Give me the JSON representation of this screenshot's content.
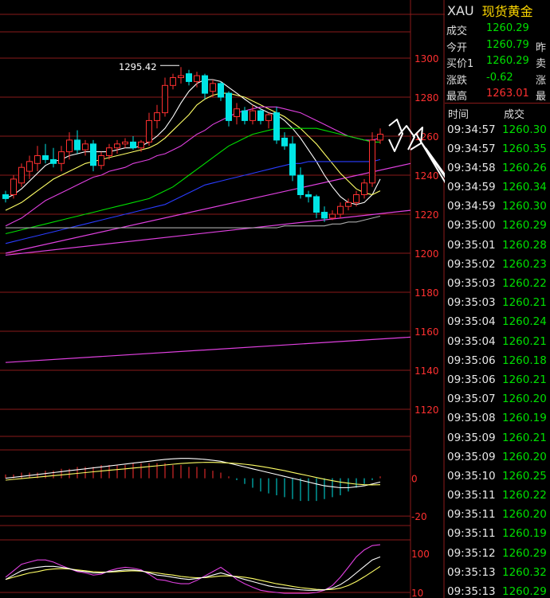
{
  "quote_panel": {
    "symbol": "XAU",
    "name": "现货黄金",
    "rows": [
      {
        "label": "成交",
        "value": "1260.29",
        "color": "green",
        "right": ""
      },
      {
        "label": "今开",
        "value": "1260.79",
        "color": "green",
        "right": "昨"
      },
      {
        "label": "买价1",
        "value": "1260.29",
        "color": "green",
        "right": "卖"
      },
      {
        "label": "涨跌",
        "value": "-0.62",
        "color": "green",
        "right": "涨"
      },
      {
        "label": "最高",
        "value": "1263.01",
        "color": "red",
        "right": "最"
      }
    ]
  },
  "ticks_panel": {
    "headers": {
      "time": "时间",
      "price": "成交"
    },
    "ticks": [
      {
        "time": "09:34:57",
        "price": "1260.30"
      },
      {
        "time": "09:34:57",
        "price": "1260.35"
      },
      {
        "time": "09:34:58",
        "price": "1260.26"
      },
      {
        "time": "09:34:59",
        "price": "1260.34"
      },
      {
        "time": "09:34:59",
        "price": "1260.30"
      },
      {
        "time": "09:35:00",
        "price": "1260.29"
      },
      {
        "time": "09:35:01",
        "price": "1260.28"
      },
      {
        "time": "09:35:02",
        "price": "1260.23"
      },
      {
        "time": "09:35:03",
        "price": "1260.22"
      },
      {
        "time": "09:35:03",
        "price": "1260.21"
      },
      {
        "time": "09:35:04",
        "price": "1260.24"
      },
      {
        "time": "09:35:04",
        "price": "1260.21"
      },
      {
        "time": "09:35:06",
        "price": "1260.18"
      },
      {
        "time": "09:35:06",
        "price": "1260.21"
      },
      {
        "time": "09:35:07",
        "price": "1260.20"
      },
      {
        "time": "09:35:08",
        "price": "1260.19"
      },
      {
        "time": "09:35:09",
        "price": "1260.21"
      },
      {
        "time": "09:35:09",
        "price": "1260.20"
      },
      {
        "time": "09:35:10",
        "price": "1260.25"
      },
      {
        "time": "09:35:11",
        "price": "1260.22"
      },
      {
        "time": "09:35:11",
        "price": "1260.20"
      },
      {
        "time": "09:35:11",
        "price": "1260.19"
      },
      {
        "time": "09:35:12",
        "price": "1260.29"
      },
      {
        "time": "09:35:13",
        "price": "1260.32"
      },
      {
        "time": "09:35:13",
        "price": "1260.29"
      }
    ]
  },
  "colors": {
    "up": "#ff3030",
    "down": "#00e5e5",
    "grid": "#8a1a1a",
    "ma_white": "#ffffff",
    "ma_yellow": "#ffff66",
    "ma_magenta": "#e040e0",
    "ma_green": "#00e000",
    "ma_blue": "#2a3cff",
    "ma_gray": "#aaaaaa"
  },
  "chart_data": [
    {
      "type": "candlestick",
      "annotation": "1295.42",
      "ylim": [
        1110,
        1310
      ],
      "yticks": [
        1300,
        1280,
        1260,
        1240,
        1220,
        1200,
        1180,
        1160,
        1140,
        1120
      ],
      "candles": [
        {
          "o": 1230,
          "h": 1232,
          "l": 1226,
          "c": 1228
        },
        {
          "o": 1230,
          "h": 1240,
          "l": 1228,
          "c": 1238
        },
        {
          "o": 1236,
          "h": 1246,
          "l": 1234,
          "c": 1244
        },
        {
          "o": 1242,
          "h": 1250,
          "l": 1238,
          "c": 1247
        },
        {
          "o": 1246,
          "h": 1255,
          "l": 1242,
          "c": 1250
        },
        {
          "o": 1250,
          "h": 1256,
          "l": 1246,
          "c": 1248
        },
        {
          "o": 1248,
          "h": 1254,
          "l": 1244,
          "c": 1246
        },
        {
          "o": 1246,
          "h": 1255,
          "l": 1242,
          "c": 1252
        },
        {
          "o": 1252,
          "h": 1262,
          "l": 1248,
          "c": 1258
        },
        {
          "o": 1258,
          "h": 1263,
          "l": 1251,
          "c": 1253
        },
        {
          "o": 1253,
          "h": 1258,
          "l": 1250,
          "c": 1256
        },
        {
          "o": 1256,
          "h": 1258,
          "l": 1242,
          "c": 1245
        },
        {
          "o": 1245,
          "h": 1252,
          "l": 1243,
          "c": 1250
        },
        {
          "o": 1250,
          "h": 1256,
          "l": 1248,
          "c": 1254
        },
        {
          "o": 1254,
          "h": 1258,
          "l": 1251,
          "c": 1256
        },
        {
          "o": 1256,
          "h": 1259,
          "l": 1254,
          "c": 1257
        },
        {
          "o": 1257,
          "h": 1260,
          "l": 1253,
          "c": 1254
        },
        {
          "o": 1254,
          "h": 1258,
          "l": 1252,
          "c": 1257
        },
        {
          "o": 1257,
          "h": 1272,
          "l": 1255,
          "c": 1268
        },
        {
          "o": 1268,
          "h": 1276,
          "l": 1264,
          "c": 1272
        },
        {
          "o": 1272,
          "h": 1290,
          "l": 1270,
          "c": 1286
        },
        {
          "o": 1286,
          "h": 1292,
          "l": 1284,
          "c": 1290
        },
        {
          "o": 1290,
          "h": 1295.42,
          "l": 1287,
          "c": 1291
        },
        {
          "o": 1292,
          "h": 1294,
          "l": 1286,
          "c": 1288
        },
        {
          "o": 1288,
          "h": 1293,
          "l": 1285,
          "c": 1291
        },
        {
          "o": 1291,
          "h": 1292,
          "l": 1279,
          "c": 1282
        },
        {
          "o": 1283,
          "h": 1289,
          "l": 1280,
          "c": 1287
        },
        {
          "o": 1287,
          "h": 1288,
          "l": 1278,
          "c": 1280
        },
        {
          "o": 1282,
          "h": 1283,
          "l": 1265,
          "c": 1268
        },
        {
          "o": 1270,
          "h": 1277,
          "l": 1266,
          "c": 1274
        },
        {
          "o": 1273,
          "h": 1275,
          "l": 1266,
          "c": 1268
        },
        {
          "o": 1268,
          "h": 1276,
          "l": 1266,
          "c": 1273
        },
        {
          "o": 1273,
          "h": 1274,
          "l": 1266,
          "c": 1268
        },
        {
          "o": 1268,
          "h": 1272,
          "l": 1264,
          "c": 1271
        },
        {
          "o": 1272,
          "h": 1275,
          "l": 1256,
          "c": 1258
        },
        {
          "o": 1259,
          "h": 1262,
          "l": 1253,
          "c": 1255
        },
        {
          "o": 1256,
          "h": 1260,
          "l": 1237,
          "c": 1240
        },
        {
          "o": 1240,
          "h": 1244,
          "l": 1228,
          "c": 1230
        },
        {
          "o": 1230,
          "h": 1232,
          "l": 1226,
          "c": 1229
        },
        {
          "o": 1229,
          "h": 1230,
          "l": 1218,
          "c": 1221
        },
        {
          "o": 1221,
          "h": 1224,
          "l": 1216,
          "c": 1218
        },
        {
          "o": 1218,
          "h": 1222,
          "l": 1217,
          "c": 1220
        },
        {
          "o": 1220,
          "h": 1226,
          "l": 1218,
          "c": 1224
        },
        {
          "o": 1224,
          "h": 1228,
          "l": 1222,
          "c": 1226
        },
        {
          "o": 1226,
          "h": 1232,
          "l": 1224,
          "c": 1230
        },
        {
          "o": 1230,
          "h": 1238,
          "l": 1228,
          "c": 1236
        },
        {
          "o": 1236,
          "h": 1262,
          "l": 1234,
          "c": 1258
        },
        {
          "o": 1258,
          "h": 1264,
          "l": 1256,
          "c": 1261
        }
      ],
      "ma_lines": [
        {
          "color": "ma_white",
          "values": [
            1228,
            1230,
            1233,
            1237,
            1241,
            1245,
            1247,
            1248,
            1250,
            1251,
            1252,
            1252,
            1252,
            1252,
            1253,
            1254,
            1254,
            1255,
            1257,
            1260,
            1264,
            1270,
            1277,
            1283,
            1287,
            1289,
            1289,
            1288,
            1285,
            1282,
            1279,
            1276,
            1274,
            1272,
            1271,
            1268,
            1264,
            1259,
            1253,
            1247,
            1240,
            1234,
            1229,
            1226,
            1225,
            1226,
            1230,
            1238
          ]
        },
        {
          "color": "ma_yellow",
          "values": [
            1222,
            1224,
            1226,
            1229,
            1232,
            1235,
            1238,
            1240,
            1242,
            1244,
            1246,
            1247,
            1248,
            1249,
            1250,
            1251,
            1252,
            1253,
            1254,
            1256,
            1259,
            1263,
            1267,
            1271,
            1276,
            1279,
            1281,
            1282,
            1282,
            1281,
            1280,
            1278,
            1276,
            1274,
            1272,
            1270,
            1267,
            1264,
            1260,
            1256,
            1251,
            1246,
            1241,
            1237,
            1233,
            1231,
            1230,
            1232
          ]
        },
        {
          "color": "ma_magenta",
          "values": [
            1214,
            1216,
            1218,
            1221,
            1224,
            1227,
            1229,
            1231,
            1233,
            1235,
            1237,
            1239,
            1240,
            1242,
            1243,
            1244,
            1246,
            1247,
            1248,
            1250,
            1251,
            1253,
            1255,
            1258,
            1261,
            1263,
            1266,
            1268,
            1270,
            1272,
            1273,
            1274,
            1275,
            1275,
            1275,
            1274,
            1273,
            1272,
            1270,
            1268,
            1266,
            1264,
            1262,
            1260,
            1259,
            1258,
            1258,
            1259
          ]
        },
        {
          "color": "ma_green",
          "values": [
            1210,
            1211,
            1212,
            1213,
            1214,
            1215,
            1216,
            1217,
            1218,
            1219,
            1220,
            1221,
            1222,
            1223,
            1224,
            1225,
            1226,
            1227,
            1228,
            1230,
            1232,
            1234,
            1237,
            1240,
            1243,
            1246,
            1249,
            1252,
            1255,
            1257,
            1259,
            1261,
            1262,
            1263,
            1264,
            1264,
            1264,
            1264,
            1264,
            1264,
            1263,
            1262,
            1261,
            1260,
            1259,
            1258,
            1257,
            1257
          ]
        },
        {
          "color": "ma_blue",
          "values": [
            1205,
            1206,
            1207,
            1208,
            1209,
            1210,
            1211,
            1212,
            1213,
            1214,
            1215,
            1216,
            1217,
            1218,
            1219,
            1220,
            1221,
            1222,
            1223,
            1224,
            1225,
            1227,
            1229,
            1231,
            1233,
            1235,
            1236,
            1237,
            1238,
            1239,
            1240,
            1241,
            1242,
            1243,
            1244,
            1245,
            1246,
            1246,
            1247,
            1247,
            1247,
            1247,
            1247,
            1247,
            1247,
            1247,
            1247,
            1248
          ]
        },
        {
          "color": "ma_gray",
          "values": [
            1213,
            1213,
            1213,
            1213,
            1213,
            1213,
            1213,
            1213,
            1213,
            1213,
            1213,
            1213,
            1213,
            1213,
            1213,
            1213,
            1213,
            1213,
            1213,
            1213,
            1213,
            1213,
            1213,
            1213,
            1213,
            1213,
            1213,
            1213,
            1213,
            1213,
            1213,
            1213,
            1213,
            1213,
            1213,
            1214,
            1214,
            1214,
            1214,
            1214,
            1214,
            1215,
            1215,
            1216,
            1216,
            1217,
            1218,
            1219
          ]
        }
      ],
      "trend_lines": [
        {
          "from": [
            0,
            1200
          ],
          "to": [
            57,
            1246
          ]
        },
        {
          "from": [
            0,
            1199
          ],
          "to": [
            57,
            1222
          ]
        },
        {
          "from": [
            0,
            1144
          ],
          "to": [
            57,
            1157
          ]
        }
      ]
    },
    {
      "type": "bar",
      "indicator": "MACD",
      "ylim": [
        -25,
        15
      ],
      "yticks": [
        0,
        -20
      ],
      "histogram": [
        2,
        2,
        3,
        3,
        3,
        4,
        4,
        5,
        5,
        6,
        6,
        6,
        7,
        7,
        7,
        7,
        8,
        8,
        8,
        8,
        8,
        7,
        7,
        6,
        6,
        5,
        4,
        3,
        1,
        -1,
        -3,
        -5,
        -7,
        -8,
        -9,
        -10,
        -11,
        -12,
        -12,
        -12,
        -11,
        -10,
        -9,
        -7,
        -5,
        -3,
        -1,
        1
      ],
      "dif": [
        0,
        0.5,
        1,
        1.5,
        2,
        2.5,
        3,
        3.5,
        4,
        4.5,
        5,
        5.5,
        6,
        6.5,
        7,
        7.5,
        8,
        8.5,
        9,
        9.5,
        10,
        10.3,
        10.5,
        10.5,
        10.3,
        10,
        9.5,
        9,
        8,
        7,
        6,
        5,
        4,
        3,
        2,
        1,
        0,
        -1,
        -2,
        -3,
        -4,
        -4.5,
        -5,
        -5,
        -4.5,
        -4,
        -3,
        -2
      ],
      "dea": [
        -1,
        -0.6,
        -0.2,
        0.2,
        0.6,
        1,
        1.4,
        1.8,
        2.2,
        2.6,
        3,
        3.4,
        3.8,
        4.2,
        4.6,
        5,
        5.4,
        5.8,
        6.2,
        6.6,
        7,
        7.4,
        7.8,
        8.1,
        8.3,
        8.4,
        8.4,
        8.3,
        8.1,
        7.8,
        7.4,
        6.9,
        6.3,
        5.6,
        4.8,
        4,
        3.1,
        2.2,
        1.3,
        0.4,
        -0.5,
        -1.3,
        -2,
        -2.6,
        -3.1,
        -3.4,
        -3.5,
        -3.4
      ]
    },
    {
      "type": "line",
      "indicator": "KDJ",
      "ylim": [
        0,
        120
      ],
      "yticks": [
        100,
        10
      ],
      "k": [
        40,
        50,
        60,
        65,
        68,
        70,
        70,
        68,
        65,
        60,
        58,
        55,
        55,
        58,
        60,
        62,
        62,
        60,
        55,
        50,
        48,
        45,
        42,
        40,
        42,
        45,
        50,
        55,
        50,
        45,
        40,
        35,
        30,
        25,
        22,
        20,
        18,
        16,
        15,
        15,
        16,
        20,
        28,
        40,
        55,
        70,
        85,
        92
      ],
      "d": [
        40,
        45,
        50,
        55,
        58,
        62,
        64,
        65,
        64,
        62,
        60,
        58,
        57,
        57,
        58,
        59,
        60,
        59,
        57,
        55,
        52,
        50,
        47,
        45,
        44,
        44,
        46,
        48,
        48,
        47,
        45,
        42,
        38,
        34,
        30,
        27,
        24,
        21,
        19,
        17,
        16,
        17,
        20,
        26,
        35,
        46,
        58,
        70
      ],
      "j": [
        45,
        60,
        75,
        80,
        85,
        85,
        80,
        72,
        65,
        58,
        55,
        50,
        52,
        60,
        65,
        68,
        66,
        62,
        52,
        40,
        38,
        33,
        30,
        30,
        38,
        48,
        58,
        68,
        55,
        40,
        30,
        22,
        15,
        12,
        10,
        8,
        8,
        8,
        8,
        10,
        15,
        26,
        45,
        68,
        92,
        108,
        118,
        120
      ]
    }
  ]
}
